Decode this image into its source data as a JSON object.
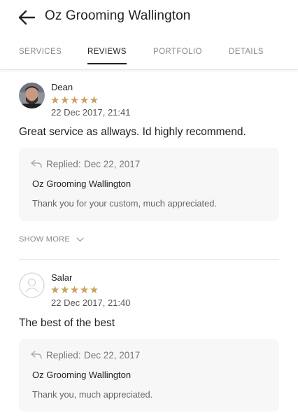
{
  "header": {
    "title": "Oz Grooming Wallington",
    "back_icon": "arrow-left-icon"
  },
  "tabs": [
    {
      "label": "SERVICES",
      "active": false
    },
    {
      "label": "REVIEWS",
      "active": true
    },
    {
      "label": "PORTFOLIO",
      "active": false
    },
    {
      "label": "DETAILS",
      "active": false
    }
  ],
  "colors": {
    "star": "#c9a25d",
    "reply_background": "#f7f7f7"
  },
  "reviews": [
    {
      "name": "Dean",
      "stars": "★★★★★",
      "rating": 5,
      "date": "22 Dec 2017, 21:41",
      "text": "Great service as allways. Id highly recommend.",
      "reply": {
        "label": "Replied:",
        "date": "Dec 22, 2017",
        "author": "Oz Grooming Wallington",
        "text": "Thank you for your custom, much appreciated."
      }
    },
    {
      "name": "Salar",
      "stars": "★★★★★",
      "rating": 5,
      "date": "22 Dec 2017, 21:40",
      "text": "The best of the best",
      "reply": {
        "label": "Replied:",
        "date": "Dec 22, 2017",
        "author": "Oz Grooming Wallington",
        "text": "Thank you, much appreciated."
      }
    }
  ],
  "show_more": {
    "label": "SHOW MORE"
  }
}
